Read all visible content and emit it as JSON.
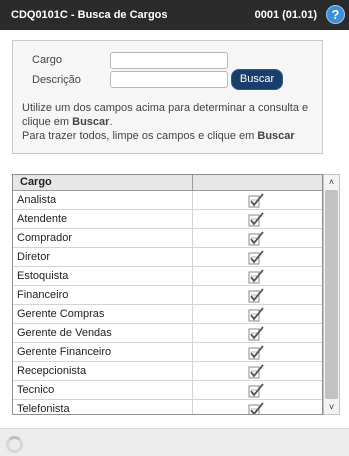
{
  "header": {
    "title": "CDQ0101C - Busca de Cargos",
    "code": "0001 (01.01)",
    "help_label": "?"
  },
  "filter": {
    "cargo_label": "Cargo",
    "cargo_value": "",
    "descricao_label": "Descrição",
    "descricao_value": "",
    "search_button": "Buscar",
    "hint_1": "Utilize um dos campos acima para determinar a consulta e clique em ",
    "hint_1_bold": "Buscar",
    "hint_1_end": ".",
    "hint_2": "Para trazer todos, limpe os campos e clique em ",
    "hint_2_bold": "Buscar"
  },
  "grid": {
    "column_header": "Cargo",
    "rows": [
      {
        "label": "Analista"
      },
      {
        "label": "Atendente"
      },
      {
        "label": "Comprador"
      },
      {
        "label": "Diretor"
      },
      {
        "label": "Estoquista"
      },
      {
        "label": "Financeiro"
      },
      {
        "label": "Gerente Compras"
      },
      {
        "label": "Gerente de Vendas"
      },
      {
        "label": "Gerente Financeiro"
      },
      {
        "label": "Recepcionista"
      },
      {
        "label": "Tecnico"
      },
      {
        "label": "Telefonista"
      }
    ],
    "row_action_icon": "select-check-icon"
  },
  "scrollbar": {
    "up_arrow": "˄",
    "down_arrow": "˅"
  },
  "colors": {
    "titlebar": "#2b2b2b",
    "button": "#1a3e6c",
    "help": "#3d8fd8"
  }
}
